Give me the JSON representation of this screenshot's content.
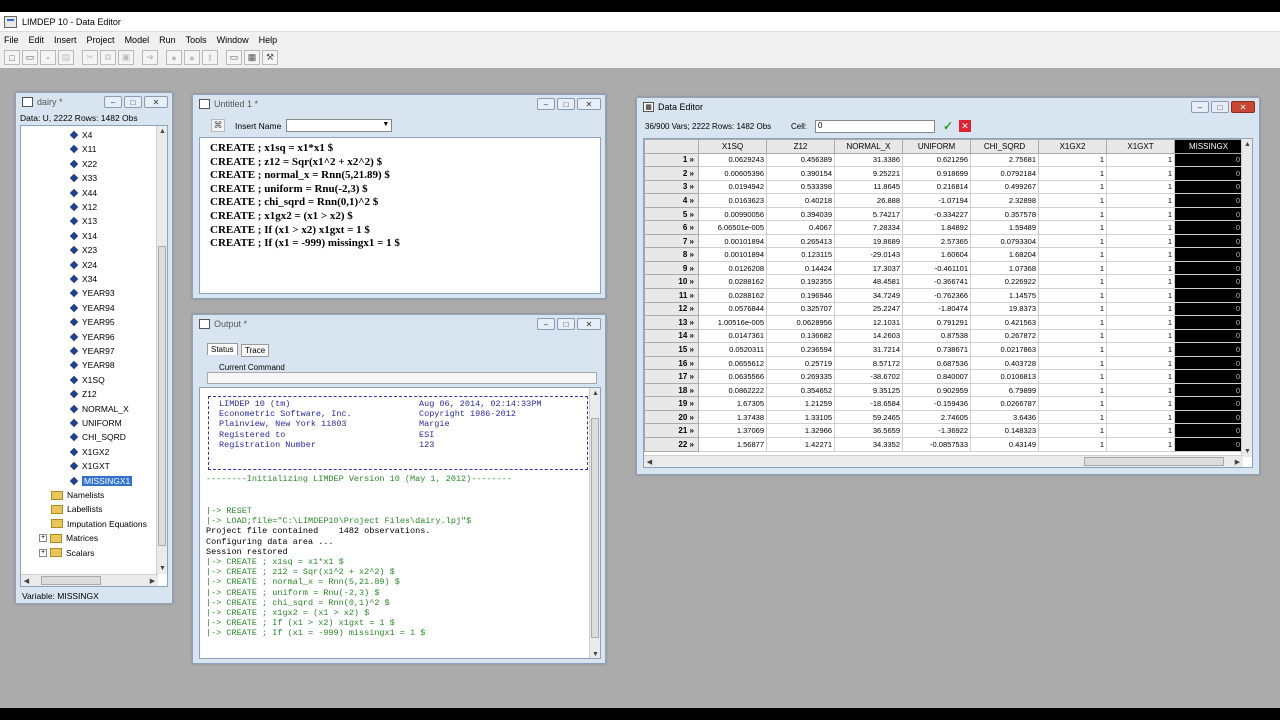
{
  "app": {
    "title": "LIMDEP 10 - Data Editor"
  },
  "menu": [
    "File",
    "Edit",
    "Insert",
    "Project",
    "Model",
    "Run",
    "Tools",
    "Window",
    "Help"
  ],
  "project_window": {
    "title": "dairy *",
    "info": "Data: U, 2222 Rows: 1482 Obs",
    "variables": [
      "X4",
      "X11",
      "X22",
      "X33",
      "X44",
      "X12",
      "X13",
      "X14",
      "X23",
      "X24",
      "X34",
      "YEAR93",
      "YEAR94",
      "YEAR95",
      "YEAR96",
      "YEAR97",
      "YEAR98",
      "X1SQ",
      "Z12",
      "NORMAL_X",
      "UNIFORM",
      "CHI_SQRD",
      "X1GX2",
      "X1GXT",
      "MISSINGX1"
    ],
    "folders": [
      "Namelists",
      "Labellists",
      "Imputation Equations",
      "Matrices",
      "Scalars"
    ],
    "status": "Variable: MISSINGX"
  },
  "editor_window": {
    "title": "Untitled 1 *",
    "insert_label": "Insert Name",
    "insert_value": "",
    "lines": [
      "CREATE ; x1sq = x1*x1 $",
      "CREATE ; z12 = Sqr(x1^2 + x2^2) $",
      "CREATE ; normal_x = Rnn(5,21.89) $",
      "CREATE ; uniform = Rnu(-2,3) $",
      "CREATE ; chi_sqrd = Rnn(0,1)^2 $",
      "CREATE ; x1gx2 = (x1 > x2) $",
      "CREATE ; If (x1 > x2) x1gxt = 1 $",
      "CREATE ; If (x1 = -999) missingx1 = 1 $"
    ]
  },
  "output_window": {
    "title": "Output *",
    "tabs": [
      "Status",
      "Trace"
    ],
    "current_command": "Current Command",
    "banner_left": [
      "LIMDEP 10 (tm)",
      "Econometric Software, Inc.",
      "Plainview, New York 11803",
      "Registered to",
      "",
      "Registration Number"
    ],
    "banner_right": [
      "Aug 06, 2014, 02:14:33PM",
      "Copyright 1986-2012",
      "",
      "Margie",
      "ESI",
      "123"
    ],
    "init_line": "--------Initializing LIMDEP Version 10 (May 1, 2012)--------",
    "log": [
      "|-> RESET",
      "|-> LOAD;file=\"C:\\LIMDEP10\\Project Files\\dairy.lpj\"$",
      "Project file contained    1482 observations.",
      "Configuring data area ...",
      "Session restored",
      "|-> CREATE ; x1sq = x1*x1 $",
      "|-> CREATE ; z12 = Sqr(x1^2 + x2^2) $",
      "|-> CREATE ; normal_x = Rnn(5,21.89) $",
      "|-> CREATE ; uniform = Rnu(-2,3) $",
      "|-> CREATE ; chi_sqrd = Rnn(0,1)^2 $",
      "|-> CREATE ; x1gx2 = (x1 > x2) $",
      "|-> CREATE ; If (x1 > x2) x1gxt = 1 $",
      "|-> CREATE ; If (x1 = -999) missingx1 = 1 $"
    ]
  },
  "data_editor": {
    "title": "Data Editor",
    "info": "36/900 Vars; 2222 Rows: 1482 Obs",
    "cell_label": "Cell:",
    "cell_value": "0",
    "columns": [
      "X1SQ",
      "Z12",
      "NORMAL_X",
      "UNIFORM",
      "CHI_SQRD",
      "X1GX2",
      "X1GXT",
      "MISSINGX"
    ],
    "rows": [
      {
        "n": "1 »",
        "v": [
          "0.0629243",
          "0.456389",
          "31.3386",
          "0.621296",
          "2.75681",
          "1",
          "1",
          "0"
        ]
      },
      {
        "n": "2 »",
        "v": [
          "0.00605396",
          "0.390154",
          "9.25221",
          "0.918699",
          "0.0792184",
          "1",
          "1",
          "0"
        ]
      },
      {
        "n": "3 »",
        "v": [
          "0.0194942",
          "0.533398",
          "11.8645",
          "0.216814",
          "0.499267",
          "1",
          "1",
          "0"
        ]
      },
      {
        "n": "4 »",
        "v": [
          "0.0163623",
          "0.40218",
          "26.888",
          "-1.07194",
          "2.32898",
          "1",
          "1",
          "0"
        ]
      },
      {
        "n": "5 »",
        "v": [
          "0.00990056",
          "0.394039",
          "5.74217",
          "-0.334227",
          "0.357578",
          "1",
          "1",
          "0"
        ]
      },
      {
        "n": "6 »",
        "v": [
          "6.06501e-005",
          "0.4067",
          "7.28334",
          "1.84892",
          "1.59489",
          "1",
          "1",
          "0"
        ]
      },
      {
        "n": "7 »",
        "v": [
          "0.00101894",
          "0.265413",
          "19.8689",
          "2.57365",
          "0.0793304",
          "1",
          "1",
          "0"
        ]
      },
      {
        "n": "8 »",
        "v": [
          "0.00101894",
          "0.123115",
          "-29.0143",
          "1.60604",
          "1.68204",
          "1",
          "1",
          "0"
        ]
      },
      {
        "n": "9 »",
        "v": [
          "0.0126208",
          "0.14424",
          "17.3037",
          "-0.461101",
          "1.07368",
          "1",
          "1",
          "0"
        ]
      },
      {
        "n": "10 »",
        "v": [
          "0.0288162",
          "0.192355",
          "48.4581",
          "-0.366741",
          "0.226922",
          "1",
          "1",
          "0"
        ]
      },
      {
        "n": "11 »",
        "v": [
          "0.0288162",
          "0.196946",
          "34.7249",
          "-0.762366",
          "1.14575",
          "1",
          "1",
          "0"
        ]
      },
      {
        "n": "12 »",
        "v": [
          "0.0576844",
          "0.325707",
          "25.2247",
          "-1.80474",
          "19.8373",
          "1",
          "1",
          "0"
        ]
      },
      {
        "n": "13 »",
        "v": [
          "1.00516e-005",
          "0.0628956",
          "12.1031",
          "0.791291",
          "0.421563",
          "1",
          "1",
          "0"
        ]
      },
      {
        "n": "14 »",
        "v": [
          "0.0147361",
          "0.136682",
          "14.2603",
          "0.87538",
          "0.267872",
          "1",
          "1",
          "0"
        ]
      },
      {
        "n": "15 »",
        "v": [
          "0.0520311",
          "0.236594",
          "31.7214",
          "0.738671",
          "0.0217863",
          "1",
          "1",
          "0"
        ]
      },
      {
        "n": "16 »",
        "v": [
          "0.0655612",
          "0.25719",
          "8.57172",
          "0.687536",
          "0.403728",
          "1",
          "1",
          "0"
        ]
      },
      {
        "n": "17 »",
        "v": [
          "0.0635566",
          "0.269335",
          "-38.6702",
          "0.840007",
          "0.0106813",
          "1",
          "1",
          "0"
        ]
      },
      {
        "n": "18 »",
        "v": [
          "0.0862222",
          "0.354652",
          "9.35125",
          "0.902959",
          "6.79899",
          "1",
          "1",
          "0"
        ]
      },
      {
        "n": "19 »",
        "v": [
          "1.67305",
          "1.21259",
          "-18.6584",
          "-0.159436",
          "0.0266787",
          "1",
          "1",
          "0"
        ]
      },
      {
        "n": "20 »",
        "v": [
          "1.37438",
          "1.33105",
          "59.2465",
          "2.74605",
          "3.6436",
          "1",
          "1",
          "0"
        ]
      },
      {
        "n": "21 »",
        "v": [
          "1.37069",
          "1.32966",
          "36.5659",
          "-1.36922",
          "0.148323",
          "1",
          "1",
          "0"
        ]
      },
      {
        "n": "22 »",
        "v": [
          "1.56877",
          "1.42271",
          "34.3352",
          "-0.0857533",
          "0.43149",
          "1",
          "1",
          "0"
        ]
      }
    ]
  },
  "colors": {
    "desktop": "#ababab",
    "window_frame": "#d9e4f1",
    "selection": "#3373d0",
    "output_green": "#2a8a2a",
    "banner_blue": "#2a2aa0"
  }
}
